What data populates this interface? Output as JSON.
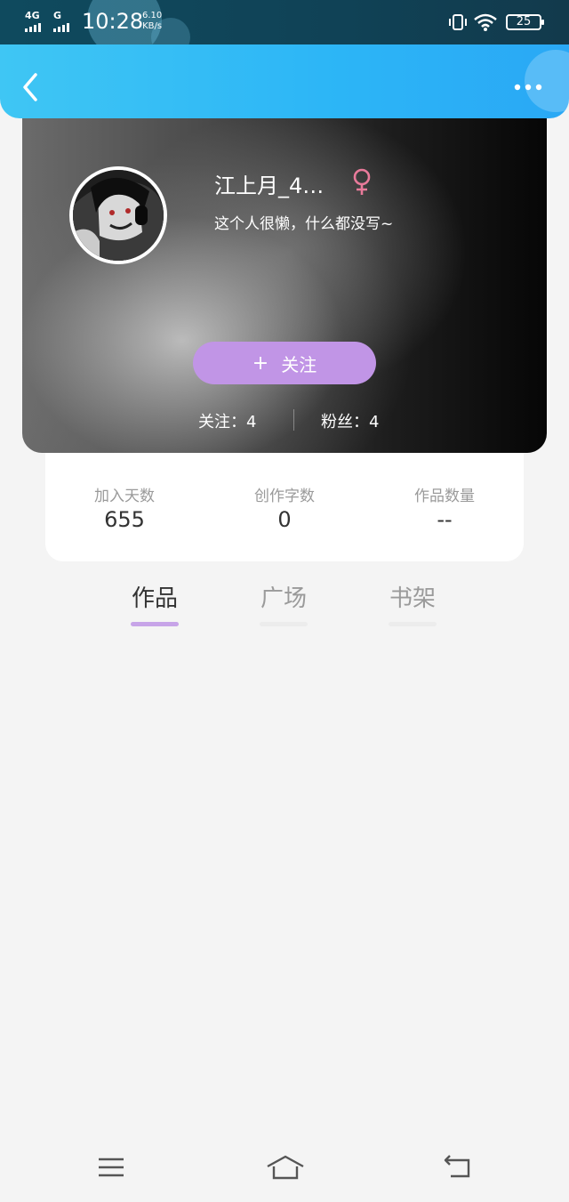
{
  "status_bar": {
    "signal1": "4G",
    "signal2": "G",
    "time": "10:28",
    "net_speed_value": "6.10",
    "net_speed_unit": "KB/s",
    "battery": "25"
  },
  "header": {
    "back_icon": "chevron-left-icon",
    "more_icon": "more-horizontal-icon"
  },
  "profile": {
    "username": "江上月_4…",
    "gender_icon": "female-icon",
    "gender_color": "#e87a9a",
    "bio": "这个人很懒，什么都没写~",
    "follow_plus": "+",
    "follow_label": "关注",
    "following": "关注：4",
    "fans": "粉丝：4",
    "follow_button_color": "#c195e6"
  },
  "stats": [
    {
      "label": "加入天数",
      "value": "655"
    },
    {
      "label": "创作字数",
      "value": "0"
    },
    {
      "label": "作品数量",
      "value": "--"
    }
  ],
  "tabs": [
    {
      "label": "作品",
      "active": true
    },
    {
      "label": "广场",
      "active": false
    },
    {
      "label": "书架",
      "active": false
    }
  ],
  "nav_bar": {
    "menu_icon": "menu-icon",
    "home_icon": "home-icon",
    "back_icon": "back-icon"
  },
  "colors": {
    "header_accent": "#2cb5f6",
    "tab_indicator": "#c7a4e8",
    "background": "#f4f4f4"
  }
}
